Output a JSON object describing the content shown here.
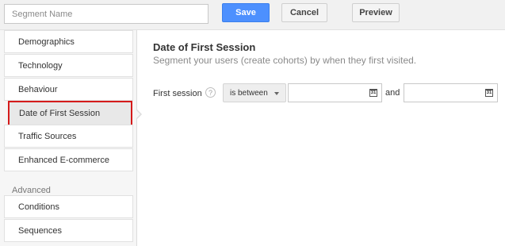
{
  "toolbar": {
    "segment_name_placeholder": "Segment Name",
    "segment_name_value": "",
    "save_label": "Save",
    "cancel_label": "Cancel",
    "preview_label": "Preview",
    "save_color": "#4d90fe"
  },
  "sidebar": {
    "items": [
      {
        "label": "Demographics"
      },
      {
        "label": "Technology"
      },
      {
        "label": "Behaviour"
      },
      {
        "label": "Date of First Session",
        "selected": true
      },
      {
        "label": "Traffic Sources"
      },
      {
        "label": "Enhanced E-commerce"
      }
    ],
    "group_label": "Advanced",
    "advanced_items": [
      {
        "label": "Conditions"
      },
      {
        "label": "Sequences"
      }
    ],
    "selected_highlight_color": "#d51b1b"
  },
  "main": {
    "title": "Date of First Session",
    "subtitle": "Segment your users (create cohorts) by when they first visited.",
    "filter": {
      "label": "First session",
      "help_icon": "?",
      "operator": "is between",
      "start_date": "",
      "end_date": "",
      "and_label": "and",
      "calendar_icon_text": "31"
    }
  }
}
